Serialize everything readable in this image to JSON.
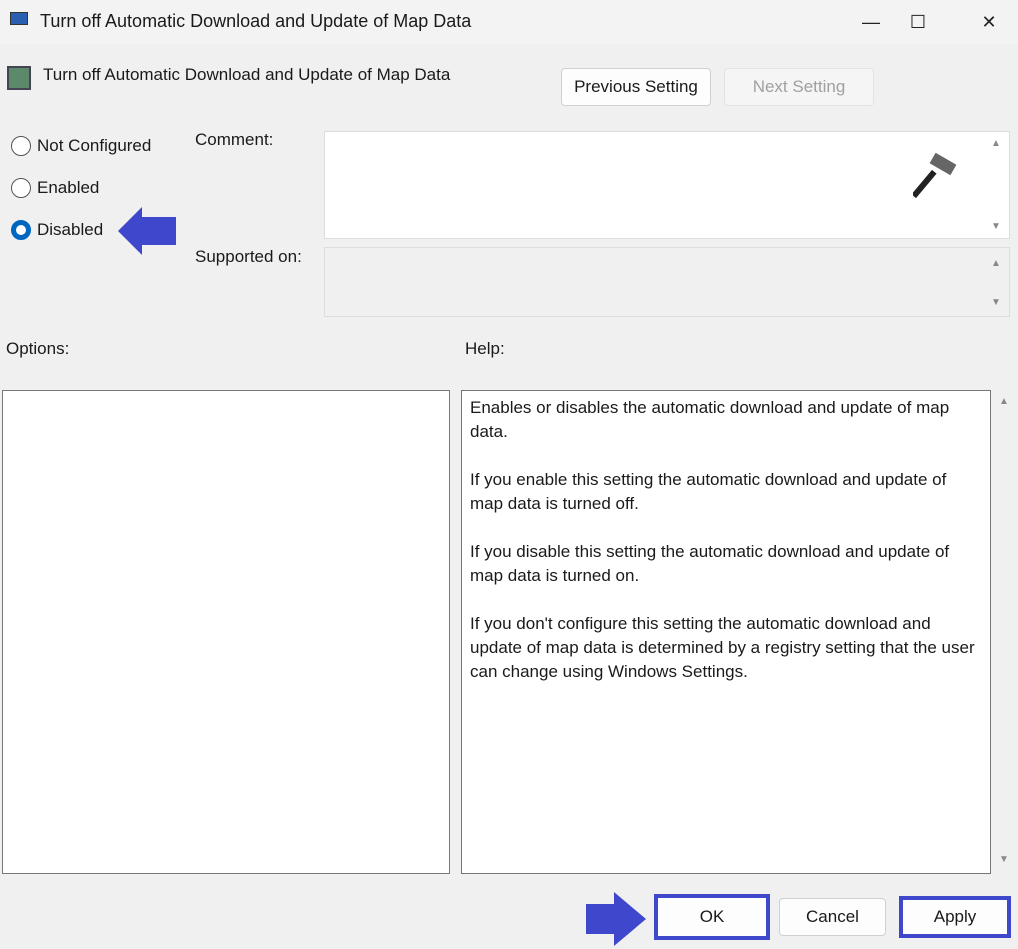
{
  "window": {
    "title": "Turn off Automatic Download and Update of Map Data",
    "minimize": "—",
    "maximize": "☐",
    "close": "✕"
  },
  "header": {
    "policy_title": "Turn off Automatic Download and Update of Map Data",
    "previous": "Previous Setting",
    "next": "Next Setting"
  },
  "state": {
    "options": [
      {
        "label": "Not Configured",
        "selected": false
      },
      {
        "label": "Enabled",
        "selected": false
      },
      {
        "label": "Disabled",
        "selected": true
      }
    ]
  },
  "labels": {
    "comment": "Comment:",
    "supported": "Supported on:",
    "options": "Options:",
    "help": "Help:"
  },
  "help": [
    "Enables or disables the automatic download and update of map data.",
    "If you enable this setting the automatic download and update of map data is turned off.",
    "If you disable this setting the automatic download and update of map data is turned on.",
    "If you don't configure this setting the automatic download and update of map data is determined by a registry setting that the user can change using Windows Settings."
  ],
  "footer": {
    "ok": "OK",
    "cancel": "Cancel",
    "apply": "Apply"
  },
  "colors": {
    "annotation": "#3f48cc",
    "accent": "#0067c0"
  }
}
